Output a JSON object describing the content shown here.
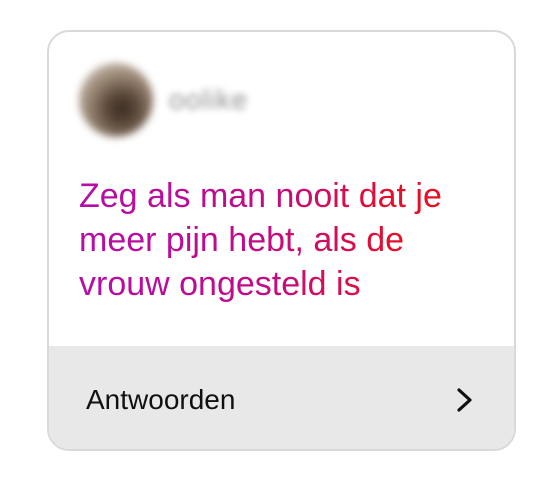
{
  "post": {
    "username": "oolike",
    "avatar_icon": "profile-avatar",
    "headline": "Zeg als man nooit dat je meer pijn hebt, als de vrouw ongesteld is",
    "headline_gradient": [
      "#b30fa8",
      "#e60f14"
    ]
  },
  "reply": {
    "label": "Antwoorden",
    "icon": "chevron-right-icon"
  }
}
